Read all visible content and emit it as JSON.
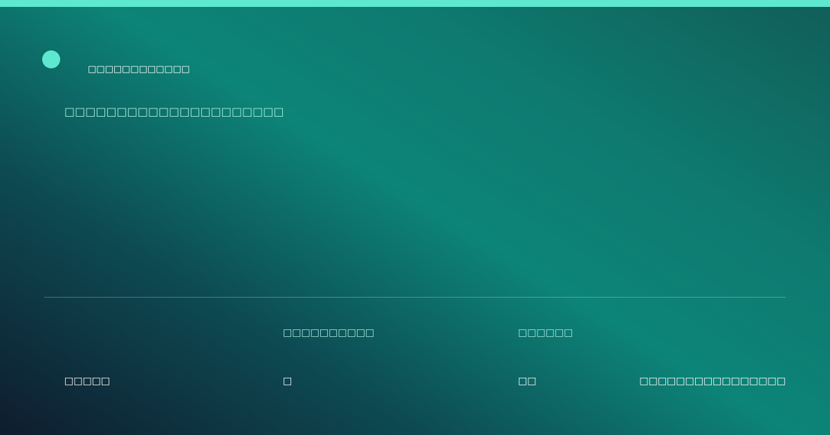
{
  "colors": {
    "accent": "#5ee8d0",
    "label_text": "#a8ece0",
    "gradient_dark": "#0f1c2e",
    "gradient_teal": "#0d8478"
  },
  "brand": {
    "icon": "brand-dot-icon",
    "name": "□□□□□□□□□□□□"
  },
  "headline": "□□□□□□□□□□□□□□□□□□□□□",
  "meta": {
    "label_2": "□□□□□□□□□□",
    "label_3": "□□□□□□",
    "value_1": "□□□□□",
    "value_2": "□",
    "value_3": "□□",
    "value_4": "□□□□□□□□□□□□□□□□"
  }
}
